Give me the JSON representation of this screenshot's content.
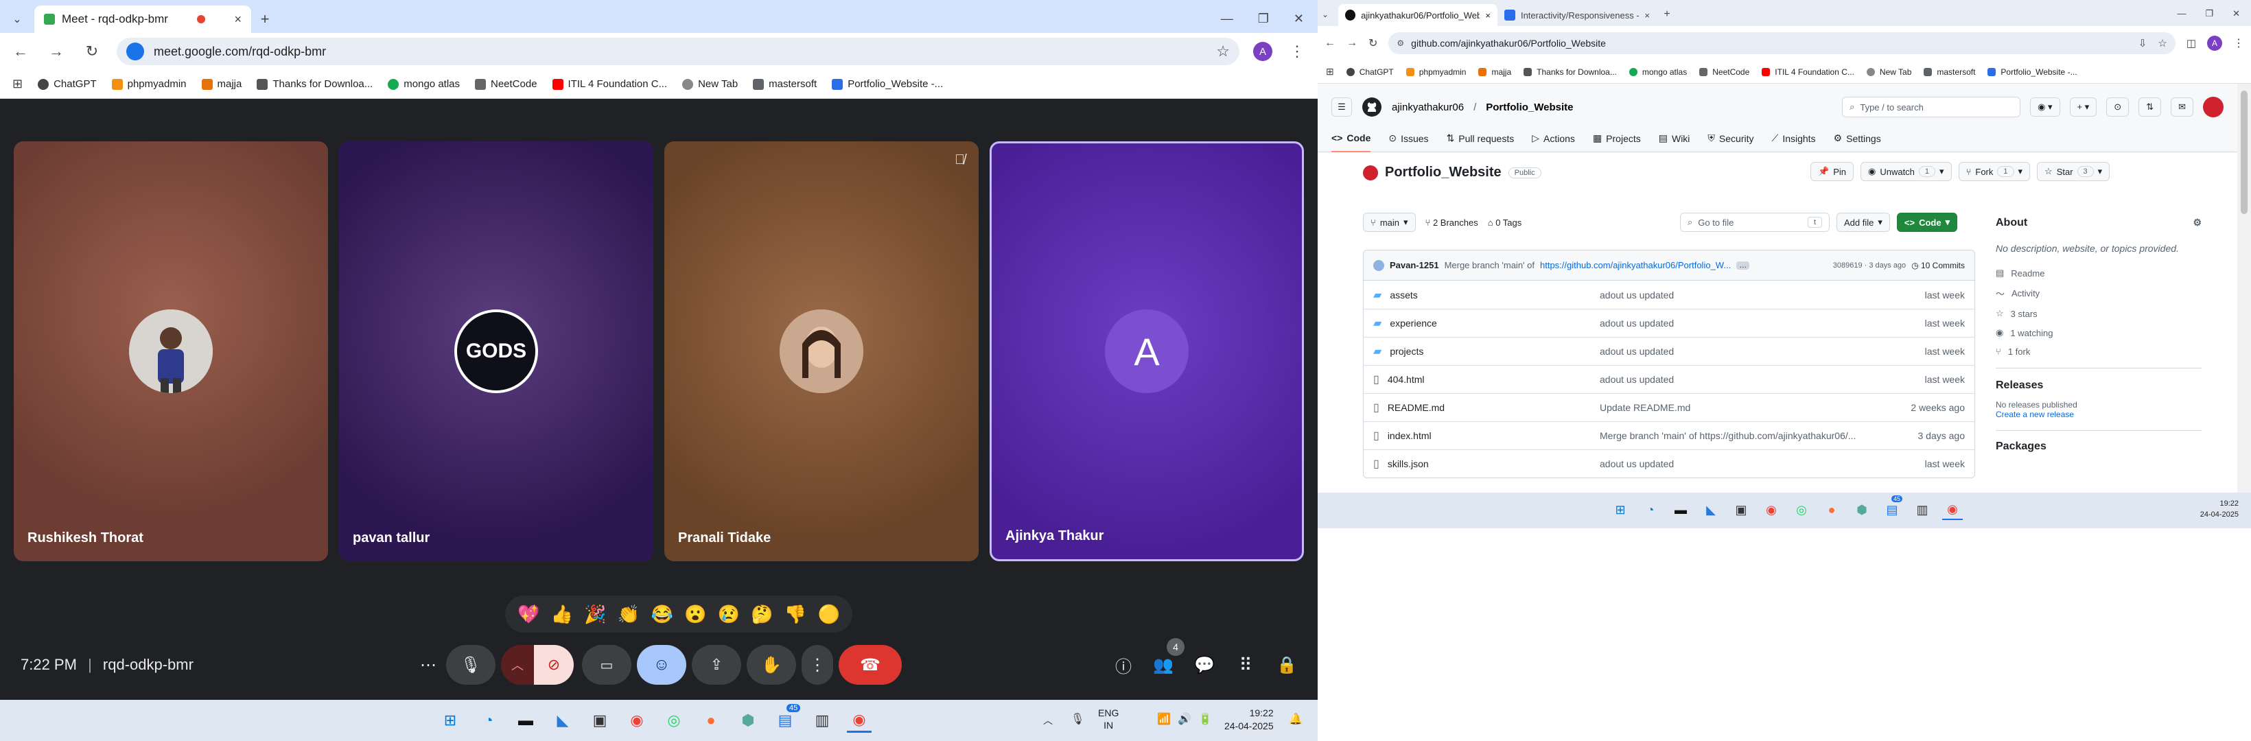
{
  "meet_window": {
    "tabs": [
      {
        "title": "Meet - rqd-odkp-bmr"
      }
    ],
    "new_tab_symbol": "+",
    "url": "meet.google.com/rqd-odkp-bmr",
    "bookmarks": [
      "ChatGPT",
      "phpmyadmin",
      "majja",
      "Thanks for Downloa...",
      "mongo atlas",
      "NeetCode",
      "ITIL 4 Foundation C...",
      "New Tab",
      "mastersoft",
      "Portfolio_Website -..."
    ],
    "participants": [
      {
        "name": "Rushikesh Thorat",
        "bg": "#7d4a3c"
      },
      {
        "name": "pavan tallur",
        "bg": "#3a1c5e"
      },
      {
        "name": "Pranali Tidake",
        "bg": "#7a4a30"
      },
      {
        "name": "Ajinkya Thakur",
        "bg": "#5a2bb0",
        "initial": "A"
      }
    ],
    "reactions": [
      "💖",
      "👍",
      "🎉",
      "👏",
      "😂",
      "😮",
      "😢",
      "🤔",
      "👎",
      "🟡"
    ],
    "meeting_time": "7:22 PM",
    "meeting_code": "rqd-odkp-bmr",
    "people_count": "4",
    "taskbar": {
      "lang": "ENG",
      "region": "IN",
      "time": "19:22",
      "date": "24-04-2025",
      "badge_count": "45"
    }
  },
  "github_window": {
    "tabs": [
      {
        "title": "ajinkyathakur06/Portfolio_Webs"
      },
      {
        "title": "Interactivity/Responsiveness - "
      }
    ],
    "url": "github.com/ajinkyathakur06/Portfolio_Website",
    "bookmarks": [
      "ChatGPT",
      "phpmyadmin",
      "majja",
      "Thanks for Downloa...",
      "mongo atlas",
      "NeetCode",
      "ITIL 4 Foundation C...",
      "New Tab",
      "mastersoft",
      "Portfolio_Website -..."
    ],
    "owner": "ajinkyathakur06",
    "repo": "Portfolio_Website",
    "search_placeholder": "Type / to search",
    "nav": [
      "Code",
      "Issues",
      "Pull requests",
      "Actions",
      "Projects",
      "Wiki",
      "Security",
      "Insights",
      "Settings"
    ],
    "visibility": "Public",
    "actions": {
      "pin": "Pin",
      "unwatch": "Unwatch",
      "unwatch_count": "1",
      "fork": "Fork",
      "fork_count": "1",
      "star": "Star",
      "star_count": "3"
    },
    "branch": "main",
    "branches": "2 Branches",
    "tags": "0 Tags",
    "goto_placeholder": "Go to file",
    "goto_key": "t",
    "add_file": "Add file",
    "code_btn": "Code",
    "commit": {
      "author": "Pavan-1251",
      "message": "Merge branch 'main' of ",
      "link": "https://github.com/ajinkyathakur06/Portfolio_W...",
      "hash": "3089619 · 3 days ago",
      "commits": "10 Commits"
    },
    "files": [
      {
        "name": "assets",
        "type": "dir",
        "msg": "adout us updated",
        "date": "last week"
      },
      {
        "name": "experience",
        "type": "dir",
        "msg": "adout us updated",
        "date": "last week"
      },
      {
        "name": "projects",
        "type": "dir",
        "msg": "adout us updated",
        "date": "last week"
      },
      {
        "name": "404.html",
        "type": "file",
        "msg": "adout us updated",
        "date": "last week"
      },
      {
        "name": "README.md",
        "type": "file",
        "msg": "Update README.md",
        "date": "2 weeks ago"
      },
      {
        "name": "index.html",
        "type": "file",
        "msg": "Merge branch 'main' of https://github.com/ajinkyathakur06/...",
        "date": "3 days ago"
      },
      {
        "name": "skills.json",
        "type": "file",
        "msg": "adout us updated",
        "date": "last week"
      }
    ],
    "about": {
      "title": "About",
      "desc": "No description, website, or topics provided.",
      "readme": "Readme",
      "activity": "Activity",
      "stars": "3 stars",
      "watching": "1 watching",
      "forks": "1 fork"
    },
    "releases": {
      "title": "Releases",
      "none": "No releases published",
      "create": "Create a new release"
    },
    "packages": {
      "title": "Packages"
    },
    "taskbar": {
      "time": "19:22",
      "date": "24-04-2025",
      "badge_count": "45"
    }
  }
}
